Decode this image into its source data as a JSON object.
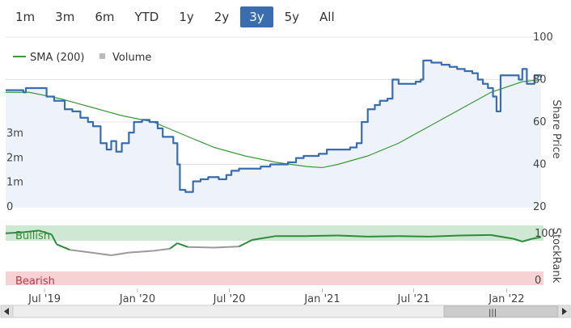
{
  "range_selector": {
    "buttons": [
      "1m",
      "3m",
      "6m",
      "YTD",
      "1y",
      "2y",
      "3y",
      "5y",
      "All"
    ],
    "active": "3y"
  },
  "colors": {
    "price": "#3a6db0",
    "sma": "#3a9a3a",
    "volume": "#bbbbbb",
    "stockrank": "#2e8b3a",
    "stockrank_low": "#9a9a9a",
    "bullish_band": "#cfe8d4",
    "bearish_band": "#f6d2d4"
  },
  "chart_data": [
    {
      "type": "line",
      "legend": [
        {
          "name": "SMA (200)",
          "symbol": "line"
        },
        {
          "name": "Volume",
          "symbol": "square"
        }
      ],
      "legend_position": "top-left",
      "xlabel": "",
      "ylabel": "Share Price",
      "x_range": [
        "2019-04-15",
        "2022-03-15"
      ],
      "ylim": [
        20,
        100
      ],
      "x_tick_labels": [
        "Jul '19",
        "Jan '20",
        "Jul '20",
        "Jan '21",
        "Jul '21",
        "Jan '22"
      ],
      "x_tick_dates": [
        "2019-07-01",
        "2020-01-01",
        "2020-07-01",
        "2021-01-01",
        "2021-07-01",
        "2022-01-01"
      ],
      "y_ticks": [
        20,
        40,
        60,
        80,
        100
      ],
      "grid": true,
      "series": [
        {
          "name": "",
          "role": "share-price",
          "points": [
            [
              "2019-04-15",
              75
            ],
            [
              "2019-05-10",
              75
            ],
            [
              "2019-05-20",
              74
            ],
            [
              "2019-05-25",
              76
            ],
            [
              "2019-06-20",
              76
            ],
            [
              "2019-07-05",
              72
            ],
            [
              "2019-07-20",
              70
            ],
            [
              "2019-08-10",
              66
            ],
            [
              "2019-08-25",
              65
            ],
            [
              "2019-09-10",
              62
            ],
            [
              "2019-09-25",
              60
            ],
            [
              "2019-10-05",
              58
            ],
            [
              "2019-10-20",
              50
            ],
            [
              "2019-11-01",
              47
            ],
            [
              "2019-11-10",
              51
            ],
            [
              "2019-11-20",
              46
            ],
            [
              "2019-12-01",
              50
            ],
            [
              "2019-12-15",
              55
            ],
            [
              "2019-12-25",
              60
            ],
            [
              "2020-01-10",
              61
            ],
            [
              "2020-01-25",
              60
            ],
            [
              "2020-02-10",
              57
            ],
            [
              "2020-02-20",
              53
            ],
            [
              "2020-03-05",
              53
            ],
            [
              "2020-03-12",
              50
            ],
            [
              "2020-03-20",
              40
            ],
            [
              "2020-03-25",
              28
            ],
            [
              "2020-04-05",
              27
            ],
            [
              "2020-04-20",
              32
            ],
            [
              "2020-05-05",
              33
            ],
            [
              "2020-05-20",
              34
            ],
            [
              "2020-06-10",
              33
            ],
            [
              "2020-06-25",
              35
            ],
            [
              "2020-07-05",
              37
            ],
            [
              "2020-07-20",
              38
            ],
            [
              "2020-08-10",
              38
            ],
            [
              "2020-09-01",
              39
            ],
            [
              "2020-09-20",
              40
            ],
            [
              "2020-10-10",
              40
            ],
            [
              "2020-10-25",
              41
            ],
            [
              "2020-11-10",
              43
            ],
            [
              "2020-11-25",
              44
            ],
            [
              "2020-12-10",
              44
            ],
            [
              "2020-12-25",
              45
            ],
            [
              "2021-01-10",
              47
            ],
            [
              "2021-01-25",
              47
            ],
            [
              "2021-02-15",
              47
            ],
            [
              "2021-02-25",
              48
            ],
            [
              "2021-03-10",
              50
            ],
            [
              "2021-03-20",
              60
            ],
            [
              "2021-04-01",
              66
            ],
            [
              "2021-04-15",
              68
            ],
            [
              "2021-04-25",
              70
            ],
            [
              "2021-05-10",
              71
            ],
            [
              "2021-05-20",
              80
            ],
            [
              "2021-06-01",
              78
            ],
            [
              "2021-06-20",
              78
            ],
            [
              "2021-07-05",
              79
            ],
            [
              "2021-07-15",
              80
            ],
            [
              "2021-07-20",
              89
            ],
            [
              "2021-08-05",
              88
            ],
            [
              "2021-08-25",
              87
            ],
            [
              "2021-09-10",
              86
            ],
            [
              "2021-09-25",
              85
            ],
            [
              "2021-10-10",
              84
            ],
            [
              "2021-10-25",
              83
            ],
            [
              "2021-11-05",
              80
            ],
            [
              "2021-11-15",
              78
            ],
            [
              "2021-11-25",
              76
            ],
            [
              "2021-12-05",
              72
            ],
            [
              "2021-12-12",
              65
            ],
            [
              "2021-12-20",
              82
            ],
            [
              "2022-01-10",
              82
            ],
            [
              "2022-01-25",
              80
            ],
            [
              "2022-02-01",
              85
            ],
            [
              "2022-02-10",
              78
            ],
            [
              "2022-02-25",
              82
            ],
            [
              "2022-03-10",
              81
            ]
          ]
        },
        {
          "name": "SMA (200)",
          "role": "sma",
          "points": [
            [
              "2019-04-15",
              74
            ],
            [
              "2019-06-01",
              74
            ],
            [
              "2019-08-01",
              71
            ],
            [
              "2019-10-01",
              67
            ],
            [
              "2019-12-01",
              63
            ],
            [
              "2020-02-01",
              60
            ],
            [
              "2020-04-01",
              54
            ],
            [
              "2020-06-01",
              48
            ],
            [
              "2020-08-01",
              44
            ],
            [
              "2020-10-01",
              41
            ],
            [
              "2020-12-01",
              39
            ],
            [
              "2021-01-01",
              38.5
            ],
            [
              "2021-02-01",
              40
            ],
            [
              "2021-04-01",
              44
            ],
            [
              "2021-06-01",
              50
            ],
            [
              "2021-08-01",
              58
            ],
            [
              "2021-10-01",
              66
            ],
            [
              "2021-12-01",
              74
            ],
            [
              "2022-02-01",
              79
            ],
            [
              "2022-03-10",
              80
            ]
          ]
        }
      ]
    },
    {
      "type": "bar",
      "role": "volume",
      "name": "Volume",
      "y_ticks": [
        "0",
        "1m",
        "2m",
        "3m"
      ],
      "ylim": [
        0,
        3.5
      ],
      "x": [
        "2019-04-25",
        "2019-06-15",
        "2019-09-10",
        "2019-10-20",
        "2019-12-01",
        "2020-01-15",
        "2020-02-20",
        "2020-03-23",
        "2020-05-10",
        "2020-07-15",
        "2020-09-10",
        "2020-11-05",
        "2021-01-15",
        "2021-03-15",
        "2021-05-10",
        "2021-07-20",
        "2021-09-10",
        "2021-11-15",
        "2022-01-10",
        "2022-02-15"
      ],
      "values": [
        2.3,
        0.3,
        0.25,
        0.2,
        0.15,
        0.3,
        0.25,
        1.1,
        0.2,
        0.15,
        0.1,
        0.15,
        0.12,
        0.15,
        0.2,
        0.5,
        0.15,
        0.2,
        0.35,
        0.2
      ]
    },
    {
      "type": "line",
      "role": "stockrank",
      "name": "",
      "ylabel": "StockRank",
      "y_ticks": [
        0,
        100
      ],
      "ylim": [
        0,
        100
      ],
      "bands": [
        "Bullish",
        "Bearish"
      ],
      "points": [
        [
          "2019-04-15",
          90
        ],
        [
          "2019-05-20",
          92
        ],
        [
          "2019-06-20",
          95
        ],
        [
          "2019-07-15",
          88
        ],
        [
          "2019-07-25",
          70
        ],
        [
          "2019-08-20",
          60
        ],
        [
          "2019-10-01",
          55
        ],
        [
          "2019-11-10",
          50
        ],
        [
          "2019-12-15",
          55
        ],
        [
          "2020-02-01",
          58
        ],
        [
          "2020-03-05",
          62
        ],
        [
          "2020-03-20",
          72
        ],
        [
          "2020-04-10",
          65
        ],
        [
          "2020-06-01",
          64
        ],
        [
          "2020-07-20",
          66
        ],
        [
          "2020-08-15",
          78
        ],
        [
          "2020-10-01",
          85
        ],
        [
          "2020-12-01",
          85
        ],
        [
          "2021-02-01",
          86
        ],
        [
          "2021-04-01",
          84
        ],
        [
          "2021-06-01",
          85
        ],
        [
          "2021-08-01",
          84
        ],
        [
          "2021-10-01",
          86
        ],
        [
          "2021-12-01",
          87
        ],
        [
          "2022-01-15",
          80
        ],
        [
          "2022-02-01",
          75
        ],
        [
          "2022-02-20",
          80
        ],
        [
          "2022-03-10",
          83
        ]
      ]
    }
  ],
  "navigator": {
    "x_tick_labels": [
      "Jul '19",
      "Jan '20",
      "Jul '20",
      "Jan '21",
      "Jul '21",
      "Jan '22"
    ],
    "handle_glyph": "|||"
  }
}
